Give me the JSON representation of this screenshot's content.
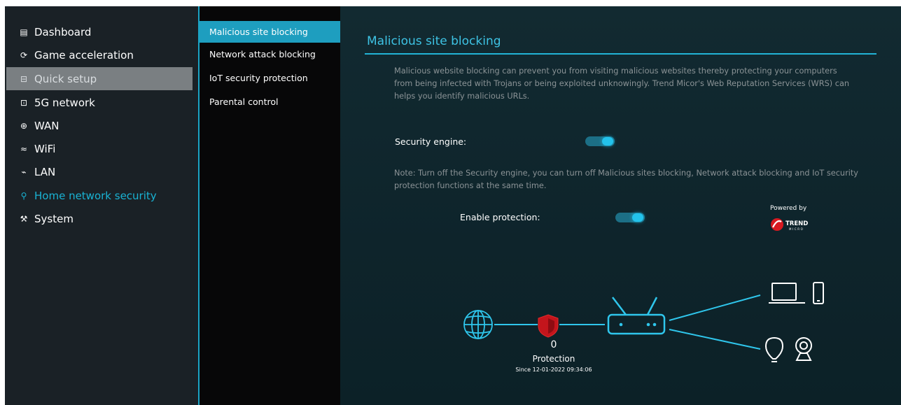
{
  "sidebar": {
    "items": [
      {
        "label": "Dashboard",
        "icon": "dashboard-icon",
        "glyph": "▤"
      },
      {
        "label": "Game acceleration",
        "icon": "speedometer-icon",
        "glyph": "⟳"
      },
      {
        "label": "Quick setup",
        "icon": "quick-setup-icon",
        "glyph": "⊟"
      },
      {
        "label": "5G network",
        "icon": "router-5g-icon",
        "glyph": "⊡"
      },
      {
        "label": "WAN",
        "icon": "globe-icon",
        "glyph": "⊕"
      },
      {
        "label": "WiFi",
        "icon": "wifi-icon",
        "glyph": "≈"
      },
      {
        "label": "LAN",
        "icon": "lan-icon",
        "glyph": "⌁"
      },
      {
        "label": "Home network security",
        "icon": "security-key-icon",
        "glyph": "⚲"
      },
      {
        "label": "System",
        "icon": "wrench-icon",
        "glyph": "⚒"
      }
    ],
    "active": "Quick setup",
    "highlighted": "Home network security"
  },
  "subnav": {
    "items": [
      "Malicious site blocking",
      "Network attack blocking",
      "IoT security protection",
      "Parental control"
    ],
    "active": "Malicious site blocking"
  },
  "page": {
    "title": "Malicious site blocking",
    "description": "Malicious website blocking can prevent you from visiting malicious websites thereby protecting your computers from being infected with Trojans or being exploited unknowingly. Trend Micor's Web Reputation Services (WRS) can helps you identify malicious URLs.",
    "security_engine_label": "Security engine:",
    "security_engine_on": true,
    "note": "Note: Turn off the Security engine, you can turn off Malicious sites blocking, Network attack blocking and IoT security protection functions at the same time.",
    "enable_protection_label": "Enable protection:",
    "enable_protection_on": true,
    "powered_by": "Powered by",
    "brand_text": "TREND",
    "brand_subtext": "MICRO"
  },
  "protection": {
    "count": "0",
    "label": "Protection",
    "since": "Since 12-01-2022 09:34:06"
  },
  "colors": {
    "accent": "#1e9ebf",
    "shield": "#c4151c",
    "line": "#2fc6ec"
  }
}
